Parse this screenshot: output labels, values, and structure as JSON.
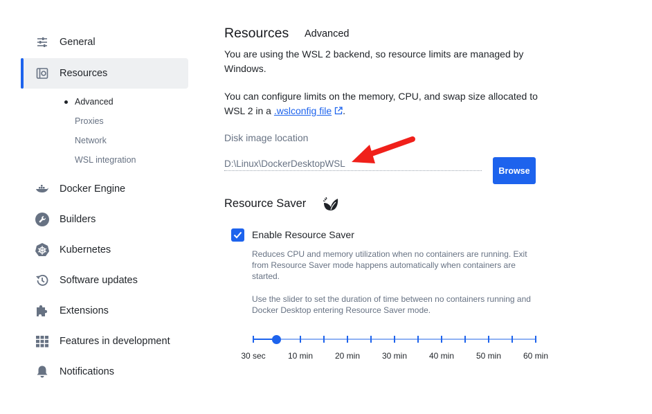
{
  "sidebar": {
    "items": [
      {
        "label": "General",
        "icon": "sliders-icon"
      },
      {
        "label": "Resources",
        "icon": "resources-icon"
      },
      {
        "label": "Docker Engine",
        "icon": "whale-icon"
      },
      {
        "label": "Builders",
        "icon": "wrench-icon"
      },
      {
        "label": "Kubernetes",
        "icon": "helm-icon"
      },
      {
        "label": "Software updates",
        "icon": "history-icon"
      },
      {
        "label": "Extensions",
        "icon": "puzzle-icon"
      },
      {
        "label": "Features in development",
        "icon": "grid-icon"
      },
      {
        "label": "Notifications",
        "icon": "bell-icon"
      }
    ],
    "sub_items": [
      {
        "label": "Advanced"
      },
      {
        "label": "Proxies"
      },
      {
        "label": "Network"
      },
      {
        "label": "WSL integration"
      }
    ]
  },
  "main": {
    "title": "Resources",
    "subtitle": "Advanced",
    "wsl_notice": "You are using the WSL 2 backend, so resource limits are managed by Windows.",
    "configure_prefix": "You can configure limits on the memory, CPU, and swap size allocated to WSL 2 in a",
    "configure_link": ".wslconfig file",
    "configure_suffix": ".",
    "disk_label": "Disk image location",
    "disk_value": "D:\\Linux\\DockerDesktopWSL",
    "browse_label": "Browse",
    "saver_title": "Resource Saver",
    "enable_label": "Enable Resource Saver",
    "enable_checked": true,
    "help_1": "Reduces CPU and memory utilization when no containers are running. Exit from Resource Saver mode happens automatically when containers are started.",
    "help_2": "Use the slider to set the duration of time between no containers running and Docker Desktop entering Resource Saver mode.",
    "slider": {
      "labels": [
        "30 sec",
        "10 min",
        "20 min",
        "30 min",
        "40 min",
        "50 min",
        "60 min"
      ],
      "value_fraction": 0.083
    }
  },
  "colors": {
    "accent": "#1d63ed",
    "annotation_arrow": "#f0201a",
    "active_bg": "#eef0f2"
  }
}
